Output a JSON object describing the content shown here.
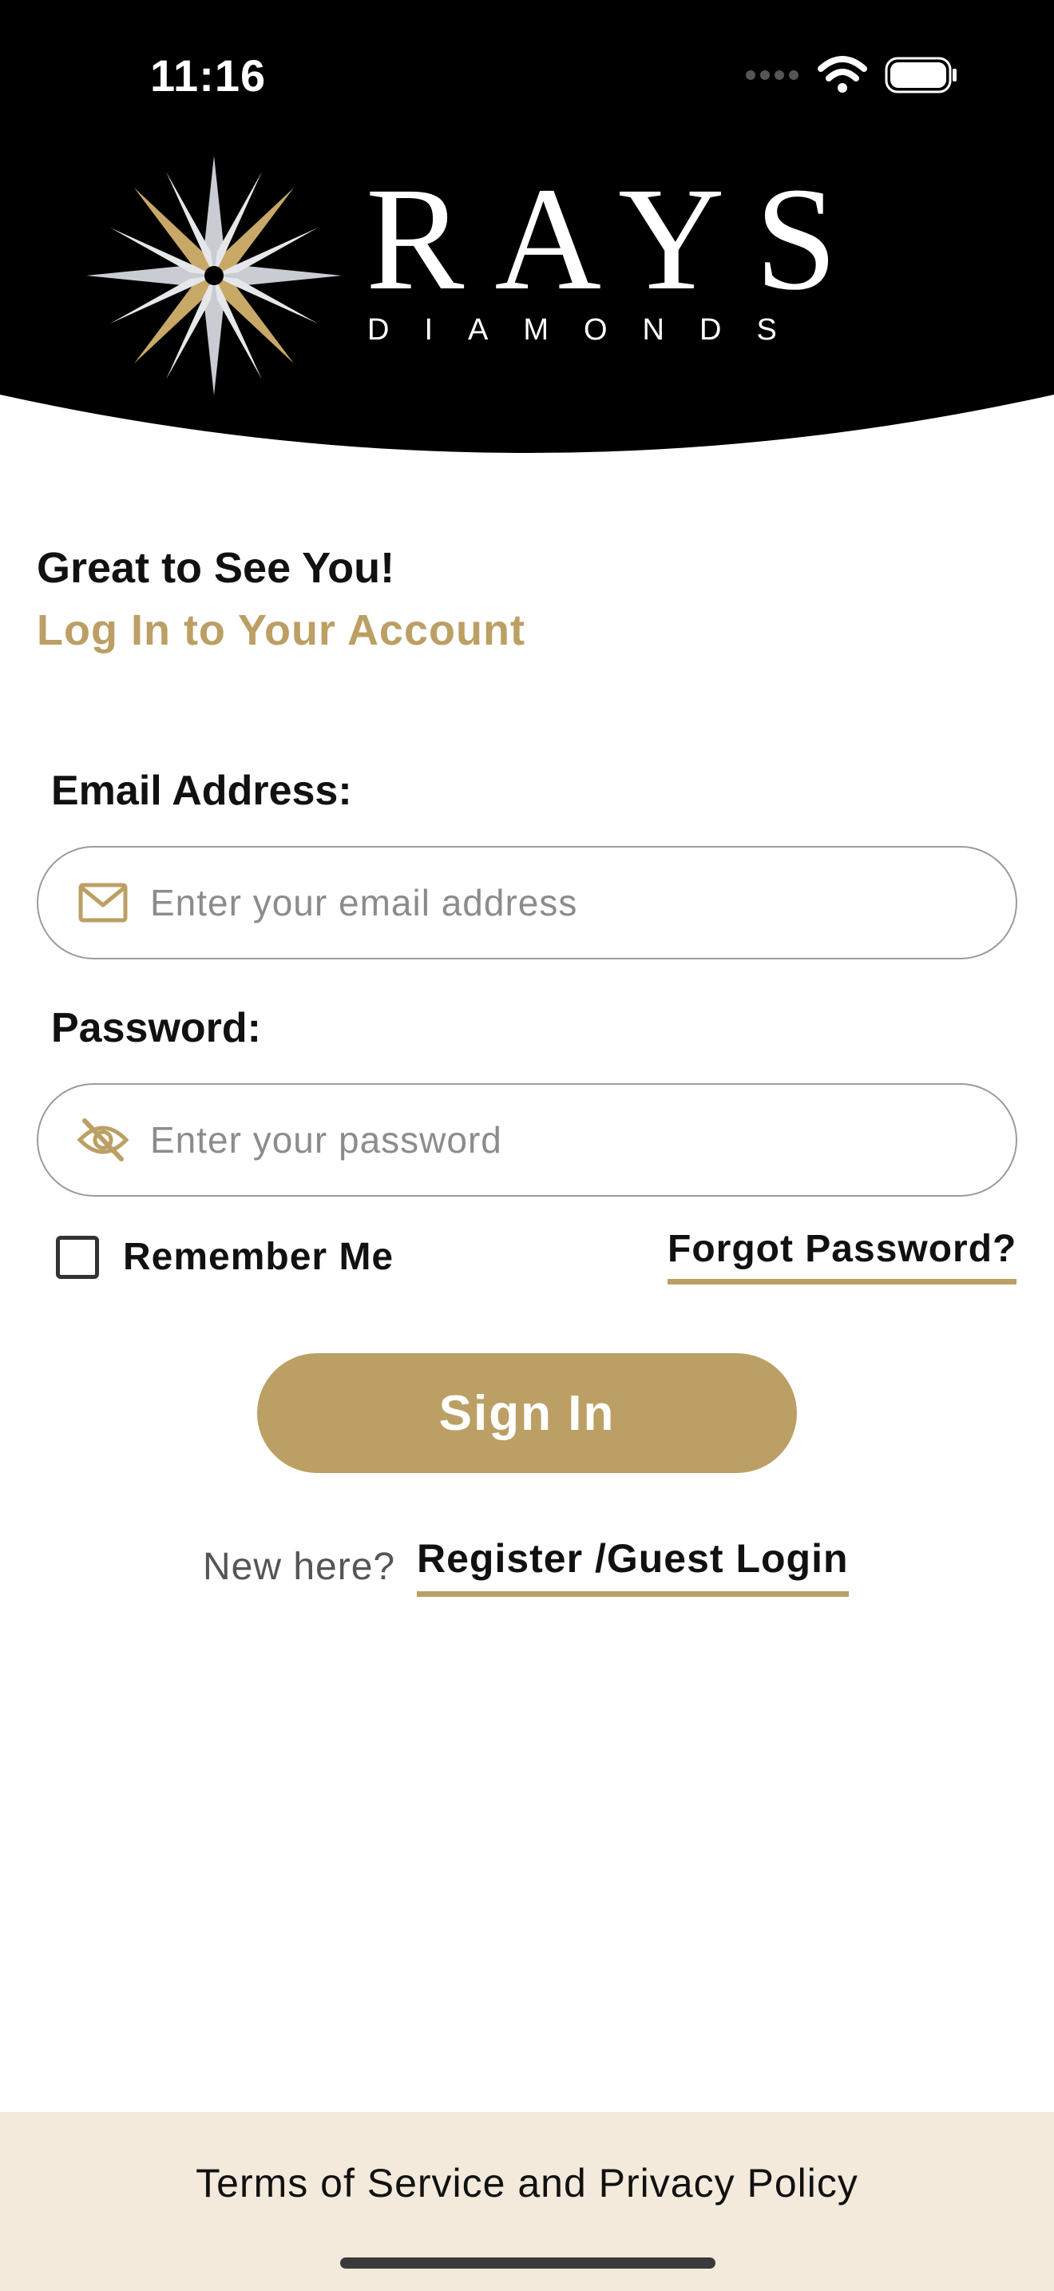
{
  "status_bar": {
    "time": "11:16",
    "icons": [
      "signal-icon",
      "wifi-icon",
      "battery-icon"
    ]
  },
  "header": {
    "brand_name": "RAYS",
    "brand_sub": "DIAMONDS",
    "logo_icon": "starburst-logo-icon",
    "background_color": "#000000",
    "accent_color": "#bc9f64"
  },
  "greeting": {
    "title": "Great to See You!",
    "subtitle": "Log In to Your Account"
  },
  "form": {
    "email_label": "Email Address:",
    "email_placeholder": "Enter your email address",
    "email_value": "",
    "email_icon": "mail-icon",
    "password_label": "Password:",
    "password_placeholder": "Enter your password",
    "password_value": "",
    "password_icon": "eye-slash-icon",
    "remember_label": "Remember Me",
    "remember_checked": false,
    "forgot_label": "Forgot Password?",
    "signin_label": "Sign In"
  },
  "register": {
    "prompt": "New here?",
    "link_label": "Register /Guest Login"
  },
  "footer": {
    "text": "Terms of Service and Privacy Policy",
    "background_color": "#f3eadb"
  }
}
